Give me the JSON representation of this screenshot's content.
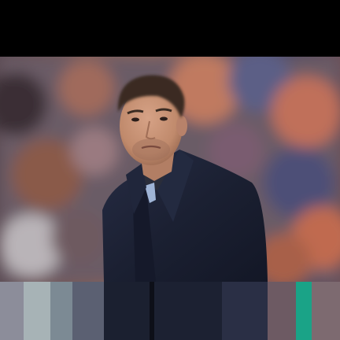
{
  "image": {
    "subject": "man-in-navy-overcoat",
    "background": "blurred-stadium-crowd",
    "palette": {
      "coat": "#1c2133",
      "shirt": "#2a2d3a",
      "tie": "#9fb4d6",
      "skin": "#c99477",
      "hair": "#3a2b22",
      "crowd_warm": "#b5705a",
      "crowd_cool": "#52567a",
      "band": "#000000"
    }
  }
}
